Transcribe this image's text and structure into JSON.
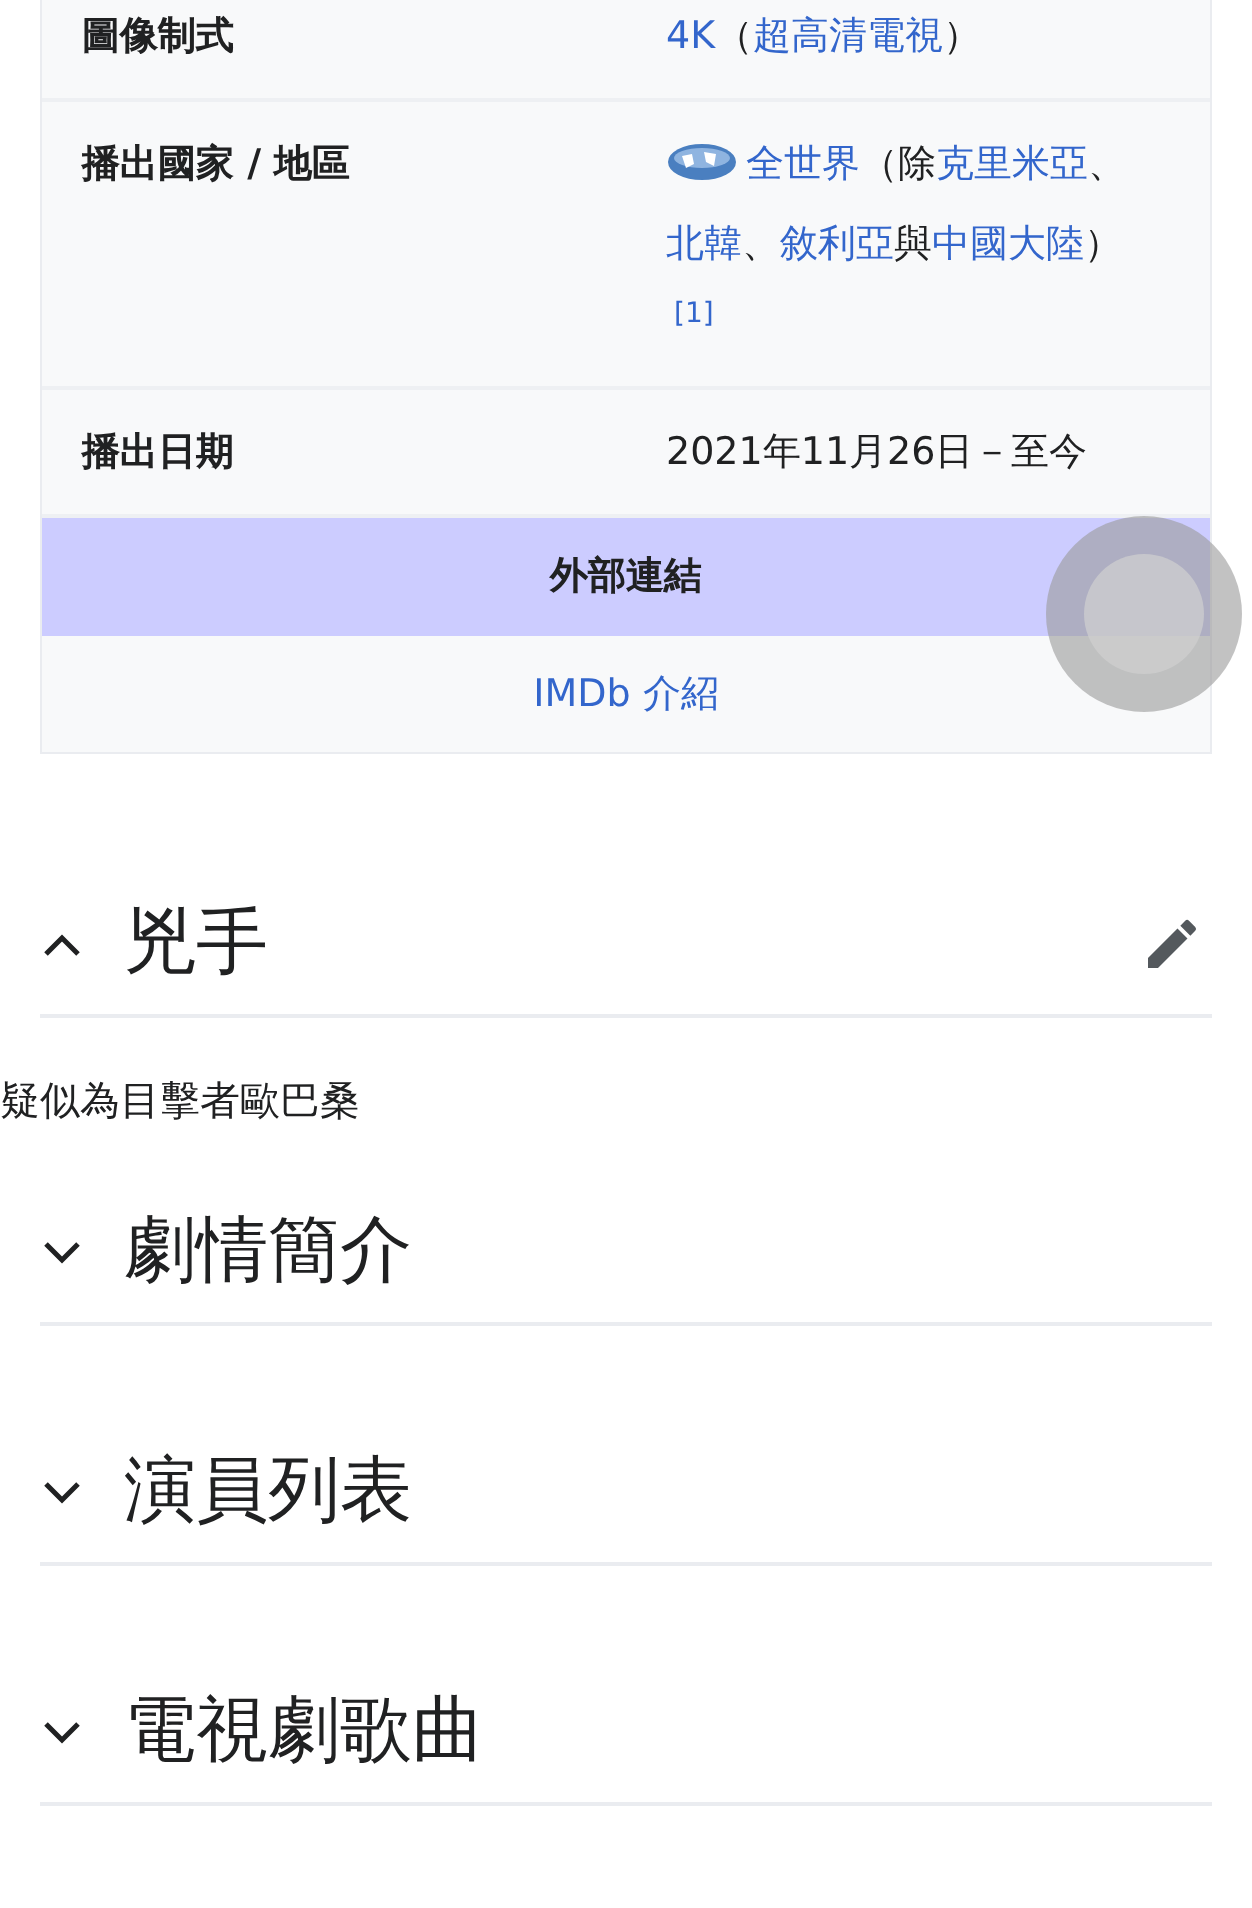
{
  "infobox": {
    "rows": [
      {
        "label": "圖像制式",
        "parts": [
          {
            "kind": "link",
            "text": "4K"
          },
          {
            "kind": "text",
            "text": "（"
          },
          {
            "kind": "link",
            "text": "超高清電視"
          },
          {
            "kind": "text",
            "text": "）"
          }
        ]
      },
      {
        "label": "播出國家 / 地區",
        "parts": [
          {
            "kind": "globe"
          },
          {
            "kind": "link",
            "text": "全世界"
          },
          {
            "kind": "text",
            "text": "（除"
          },
          {
            "kind": "link",
            "text": "克里米亞"
          },
          {
            "kind": "text",
            "text": "、"
          },
          {
            "kind": "link",
            "text": "北韓"
          },
          {
            "kind": "text",
            "text": "、"
          },
          {
            "kind": "link",
            "text": "敘利亞"
          },
          {
            "kind": "text",
            "text": "與"
          },
          {
            "kind": "link",
            "text": "中國大陸"
          },
          {
            "kind": "text",
            "text": "）"
          },
          {
            "kind": "footnote",
            "text": "[1]"
          }
        ]
      },
      {
        "label": "播出日期",
        "parts": [
          {
            "kind": "text",
            "text": "2021年11月26日－至今"
          }
        ]
      }
    ],
    "header": "外部連結",
    "links": [
      "IMDb 介紹"
    ]
  },
  "sections": [
    {
      "title": "兇手",
      "expanded": true,
      "editable": true,
      "content": "疑似為目擊者歐巴桑"
    },
    {
      "title": "劇情簡介",
      "expanded": false,
      "editable": false
    },
    {
      "title": "演員列表",
      "expanded": false,
      "editable": false
    },
    {
      "title": "電視劇歌曲",
      "expanded": false,
      "editable": false
    }
  ]
}
